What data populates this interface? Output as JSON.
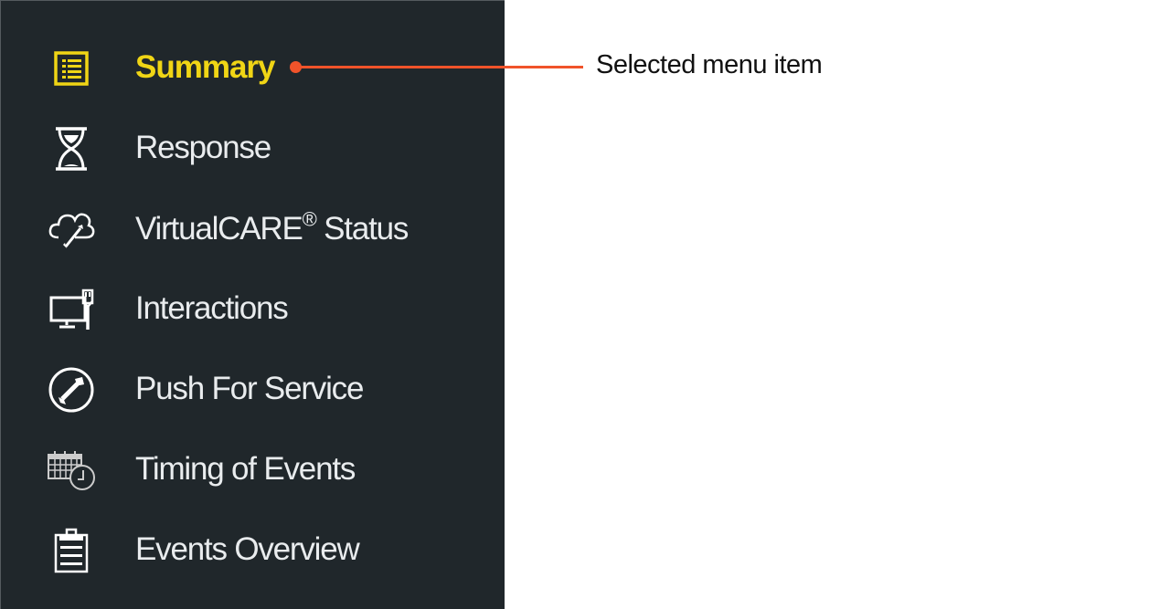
{
  "sidebar": {
    "items": [
      {
        "label": "Summary",
        "icon": "summary-list-icon",
        "selected": true
      },
      {
        "label": "Response",
        "icon": "hourglass-icon",
        "selected": false
      },
      {
        "label": "VirtualCARE",
        "label_suffix": "®",
        "label_tail": " Status",
        "icon": "cloud-wrench-icon",
        "selected": false
      },
      {
        "label": "Interactions",
        "icon": "monitor-cable-icon",
        "selected": false
      },
      {
        "label": "Push For Service",
        "icon": "wrench-circle-icon",
        "selected": false
      },
      {
        "label": "Timing of Events",
        "icon": "calendar-clock-icon",
        "selected": false
      },
      {
        "label": "Events Overview",
        "icon": "clipboard-icon",
        "selected": false
      }
    ]
  },
  "callout": {
    "text": "Selected menu item"
  },
  "colors": {
    "sidebar_bg": "#20272b",
    "selected": "#f0d515",
    "text": "#e9ecee",
    "callout": "#f0532a"
  }
}
